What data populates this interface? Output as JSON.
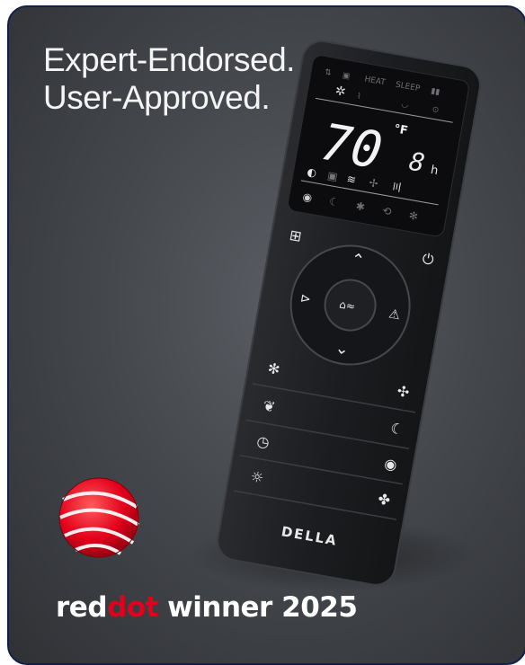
{
  "headline": {
    "line1": "Expert-Endorsed.",
    "line2": "User-Approved."
  },
  "remote": {
    "display": {
      "temperature": "70",
      "unit": "°F",
      "timer": "8",
      "timer_unit": "h"
    },
    "brand": "DELLA"
  },
  "award": {
    "prefix": "red",
    "highlight": "dot",
    "suffix": "winner 2025"
  },
  "colors": {
    "background": "#45484d",
    "remote_body": "#1c1d20",
    "award_red": "#e3001b",
    "frame_border": "#10204a"
  },
  "icons": [
    "menu-icon",
    "power-icon",
    "up-arrow-icon",
    "down-arrow-icon",
    "swing-icon",
    "sleep-mode-icon",
    "turbo-icon",
    "dry-mode-icon",
    "fan-icon",
    "eco-icon",
    "moon-icon",
    "timer-icon",
    "wifi-icon",
    "light-icon",
    "clean-icon",
    "reddot-logo-icon"
  ]
}
